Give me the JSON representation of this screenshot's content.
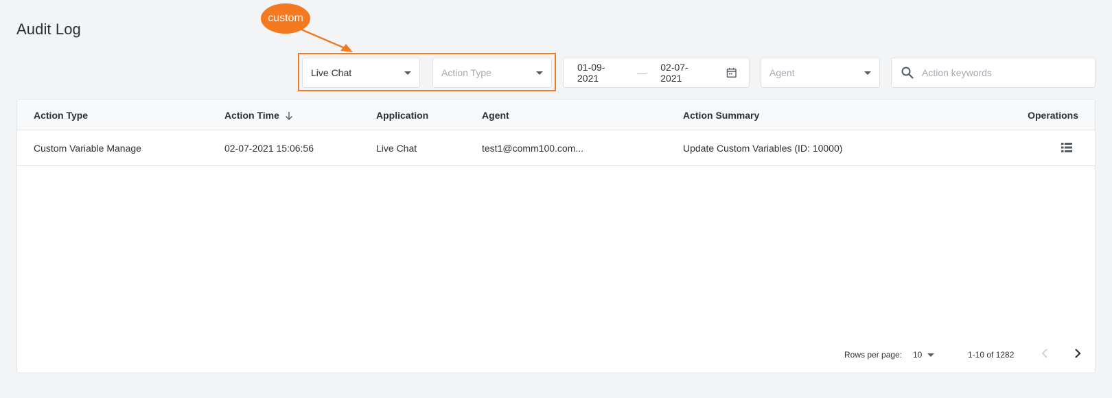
{
  "page": {
    "title": "Audit Log"
  },
  "annotation": {
    "label": "custom",
    "color": "#f47920"
  },
  "filters": {
    "application": {
      "value": "Live Chat"
    },
    "action_type": {
      "placeholder": "Action Type"
    },
    "date_range": {
      "start": "01-09-2021",
      "separator": "—",
      "end": "02-07-2021"
    },
    "agent": {
      "placeholder": "Agent"
    },
    "keywords": {
      "placeholder": "Action keywords"
    }
  },
  "table": {
    "headers": {
      "action_type": "Action Type",
      "action_time": "Action Time",
      "application": "Application",
      "agent": "Agent",
      "action_summary": "Action Summary",
      "operations": "Operations"
    },
    "rows": [
      {
        "action_type": "Custom Variable Manage",
        "action_time": "02-07-2021 15:06:56",
        "application": "Live Chat",
        "agent": "test1@comm100.com...",
        "action_summary": "Update Custom Variables (ID: 10000)"
      }
    ]
  },
  "pagination": {
    "rows_per_page_label": "Rows per page:",
    "rows_per_page_value": "10",
    "range_text": "1-10 of 1282"
  }
}
